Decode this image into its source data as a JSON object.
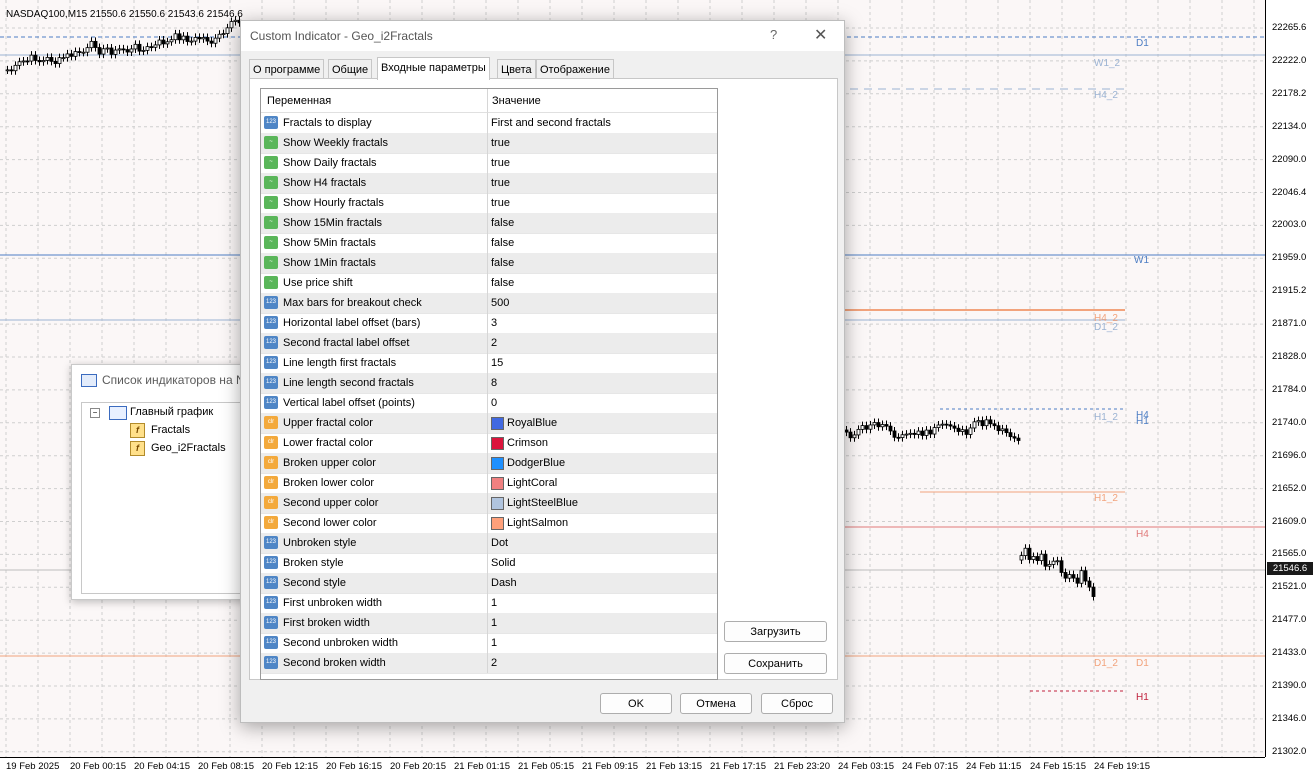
{
  "chart": {
    "symbol_label": "NASDAQ100,M15  21550.6 21550.6 21543.6 21546.6",
    "current_price": "21546.6",
    "price_ticks": [
      "22265.6",
      "22222.0",
      "22178.2",
      "22134.0",
      "22090.0",
      "22046.4",
      "22003.0",
      "21959.0",
      "21915.2",
      "21871.0",
      "21828.0",
      "21784.0",
      "21740.0",
      "21696.0",
      "21652.0",
      "21609.0",
      "21565.0",
      "21521.0",
      "21477.0",
      "21433.0",
      "21390.0",
      "21346.0",
      "21302.0"
    ],
    "time_ticks": [
      "19 Feb 2025",
      "20 Feb 00:15",
      "20 Feb 04:15",
      "20 Feb 08:15",
      "20 Feb 12:15",
      "20 Feb 16:15",
      "20 Feb 20:15",
      "21 Feb 01:15",
      "21 Feb 05:15",
      "21 Feb 09:15",
      "21 Feb 13:15",
      "21 Feb 17:15",
      "21 Feb 23:20",
      "24 Feb 03:15",
      "24 Feb 07:15",
      "24 Feb 11:15",
      "24 Feb 15:15",
      "24 Feb 19:15"
    ],
    "level_labels": [
      {
        "text": "D1",
        "color": "#4d7ec4"
      },
      {
        "text": "W1_2",
        "color": "#9bb3d3"
      },
      {
        "text": "H4_2",
        "color": "#9bb3d3"
      },
      {
        "text": "W1",
        "color": "#4d7ec4"
      },
      {
        "text": "H4_2",
        "color": "#f2a37c"
      },
      {
        "text": "D1_2",
        "color": "#9bb3d3"
      },
      {
        "text": "H1_2",
        "color": "#9bb3d3"
      },
      {
        "text": "H4",
        "color": "#4d7ec4"
      },
      {
        "text": "H1",
        "color": "#4d7ec4"
      },
      {
        "text": "H1_2",
        "color": "#f2a37c"
      },
      {
        "text": "H4",
        "color": "#e07a7a"
      },
      {
        "text": "D1_2",
        "color": "#f2a37c"
      },
      {
        "text": "D1",
        "color": "#f2a37c"
      },
      {
        "text": "H1",
        "color": "#c0203c"
      }
    ]
  },
  "indicator_list": {
    "title": "Список индикаторов на N",
    "root": "Главный график",
    "items": [
      "Fractals",
      "Geo_i2Fractals"
    ]
  },
  "dialog": {
    "title": "Custom Indicator - Geo_i2Fractals",
    "help": "?",
    "close": "✕",
    "tabs": [
      "О программе",
      "Общие",
      "Входные параметры",
      "Цвета",
      "Отображение"
    ],
    "active_tab": "Входные параметры",
    "columns": {
      "variable": "Переменная",
      "value": "Значение"
    },
    "params": [
      {
        "icon": "num",
        "name": "Fractals to display",
        "value": "First and second fractals"
      },
      {
        "icon": "bool",
        "name": "Show Weekly fractals",
        "value": "true"
      },
      {
        "icon": "bool",
        "name": "Show Daily fractals",
        "value": "true"
      },
      {
        "icon": "bool",
        "name": "Show H4 fractals",
        "value": "true"
      },
      {
        "icon": "bool",
        "name": "Show Hourly fractals",
        "value": "true"
      },
      {
        "icon": "bool",
        "name": "Show 15Min fractals",
        "value": "false"
      },
      {
        "icon": "bool",
        "name": "Show 5Min fractals",
        "value": "false"
      },
      {
        "icon": "bool",
        "name": "Show 1Min fractals",
        "value": "false"
      },
      {
        "icon": "bool",
        "name": "Use price shift",
        "value": "false"
      },
      {
        "icon": "num",
        "name": "Max bars for breakout check",
        "value": "500"
      },
      {
        "icon": "num",
        "name": "Horizontal label offset (bars)",
        "value": "3"
      },
      {
        "icon": "num",
        "name": "Second fractal label offset",
        "value": "2"
      },
      {
        "icon": "num",
        "name": "Line length first fractals",
        "value": "15"
      },
      {
        "icon": "num",
        "name": "Line length second fractals",
        "value": "8"
      },
      {
        "icon": "num",
        "name": "Vertical label offset (points)",
        "value": "0"
      },
      {
        "icon": "col",
        "name": "Upper fractal color",
        "value": "RoyalBlue",
        "swatch": "#4169e1"
      },
      {
        "icon": "col",
        "name": "Lower fractal color",
        "value": "Crimson",
        "swatch": "#dc143c"
      },
      {
        "icon": "col",
        "name": "Broken upper color",
        "value": "DodgerBlue",
        "swatch": "#1e90ff"
      },
      {
        "icon": "col",
        "name": "Broken lower color",
        "value": "LightCoral",
        "swatch": "#f08080"
      },
      {
        "icon": "col",
        "name": "Second upper color",
        "value": "LightSteelBlue",
        "swatch": "#b0c4de"
      },
      {
        "icon": "col",
        "name": "Second lower color",
        "value": "LightSalmon",
        "swatch": "#ffa07a"
      },
      {
        "icon": "num",
        "name": "Unbroken style",
        "value": "Dot"
      },
      {
        "icon": "num",
        "name": "Broken style",
        "value": "Solid"
      },
      {
        "icon": "num",
        "name": "Second style",
        "value": "Dash"
      },
      {
        "icon": "num",
        "name": "First unbroken width",
        "value": "1"
      },
      {
        "icon": "num",
        "name": "First broken width",
        "value": "1"
      },
      {
        "icon": "num",
        "name": "Second unbroken width",
        "value": "1"
      },
      {
        "icon": "num",
        "name": "Second broken width",
        "value": "2"
      }
    ],
    "side_buttons": {
      "load": "Загрузить",
      "save": "Сохранить"
    },
    "footer_buttons": {
      "ok": "OK",
      "cancel": "Отмена",
      "reset": "Сброс"
    }
  }
}
